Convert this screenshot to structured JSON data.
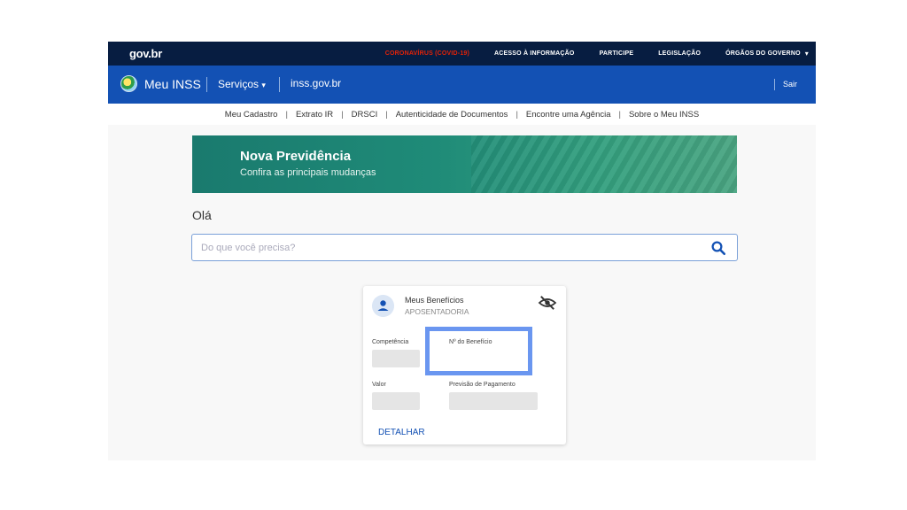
{
  "govbar": {
    "logo": "gov.br",
    "links": [
      "CORONAVÍRUS (COVID-19)",
      "ACESSO À INFORMAÇÃO",
      "PARTICIPE",
      "LEGISLAÇÃO",
      "ÓRGÃOS DO GOVERNO"
    ],
    "covid_color": "#e52207"
  },
  "inss": {
    "app_name": "Meu INSS",
    "servicos_label": "Serviços",
    "site": "inss.gov.br",
    "sair_label": "Sair"
  },
  "subnav": {
    "items": [
      "Meu Cadastro",
      "Extrato IR",
      "DRSCI",
      "Autenticidade de Documentos",
      "Encontre uma Agência",
      "Sobre o Meu INSS"
    ],
    "separator": "|"
  },
  "banner": {
    "title": "Nova Previdência",
    "subtitle": "Confira as principais mudanças"
  },
  "greeting": "Olá",
  "search": {
    "placeholder": "Do que você precisa?",
    "icon": "search-icon"
  },
  "card": {
    "title": "Meus Benefícios",
    "subtitle": "APOSENTADORIA",
    "fields": {
      "competencia": "Competência",
      "numero_beneficio": "Nº do Benefício",
      "valor": "Valor",
      "previsao": "Previsão de Pagamento"
    },
    "detalhar_label": "DETALHAR",
    "highlight_color": "#6a96f0"
  },
  "colors": {
    "govbar_bg": "#071d41",
    "inssbar_bg": "#1351b4",
    "banner_bg": "#1f8b78"
  }
}
